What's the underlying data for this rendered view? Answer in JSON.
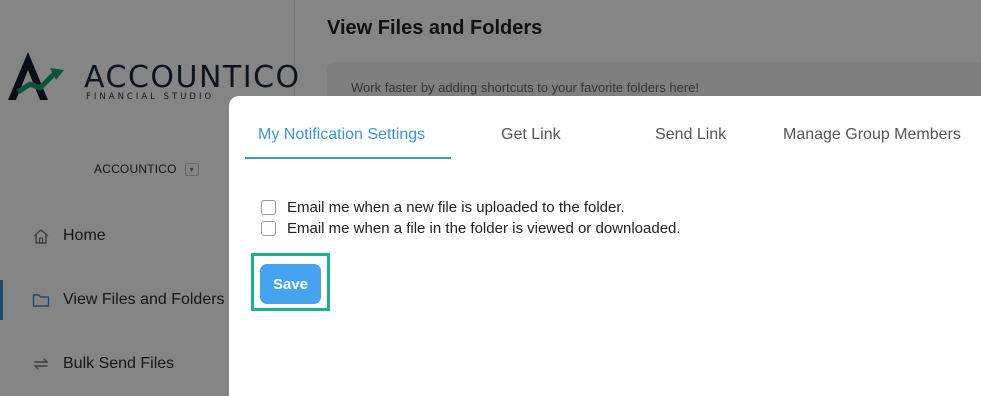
{
  "brand": {
    "name": "ACCOUNTICO",
    "tagline": "FINANCIAL STUDIO"
  },
  "account": {
    "name": "ACCOUNTICO",
    "caret_icon": "chevron-down-icon"
  },
  "sidebar": {
    "items": [
      {
        "label": "Home",
        "icon": "home-icon"
      },
      {
        "label": "View Files and Folders",
        "icon": "folder-icon",
        "active": true
      },
      {
        "label": "Bulk Send Files",
        "icon": "repeat-icon"
      }
    ]
  },
  "main": {
    "title": "View Files and Folders",
    "shortcut_hint": "Work faster by adding shortcuts to your favorite folders here!"
  },
  "modal": {
    "tabs": [
      {
        "label": "My Notification Settings",
        "active": true
      },
      {
        "label": "Get Link"
      },
      {
        "label": "Send Link"
      },
      {
        "label": "Manage Group Members"
      }
    ],
    "options": [
      {
        "label": "Email me when a new file is uploaded to the folder.",
        "checked": false
      },
      {
        "label": "Email me when a file in the folder is viewed or downloaded.",
        "checked": false
      }
    ],
    "save_label": "Save"
  },
  "colors": {
    "accent": "#3a95e6",
    "save_button": "#45a4f2",
    "highlight": "#18b48f"
  }
}
